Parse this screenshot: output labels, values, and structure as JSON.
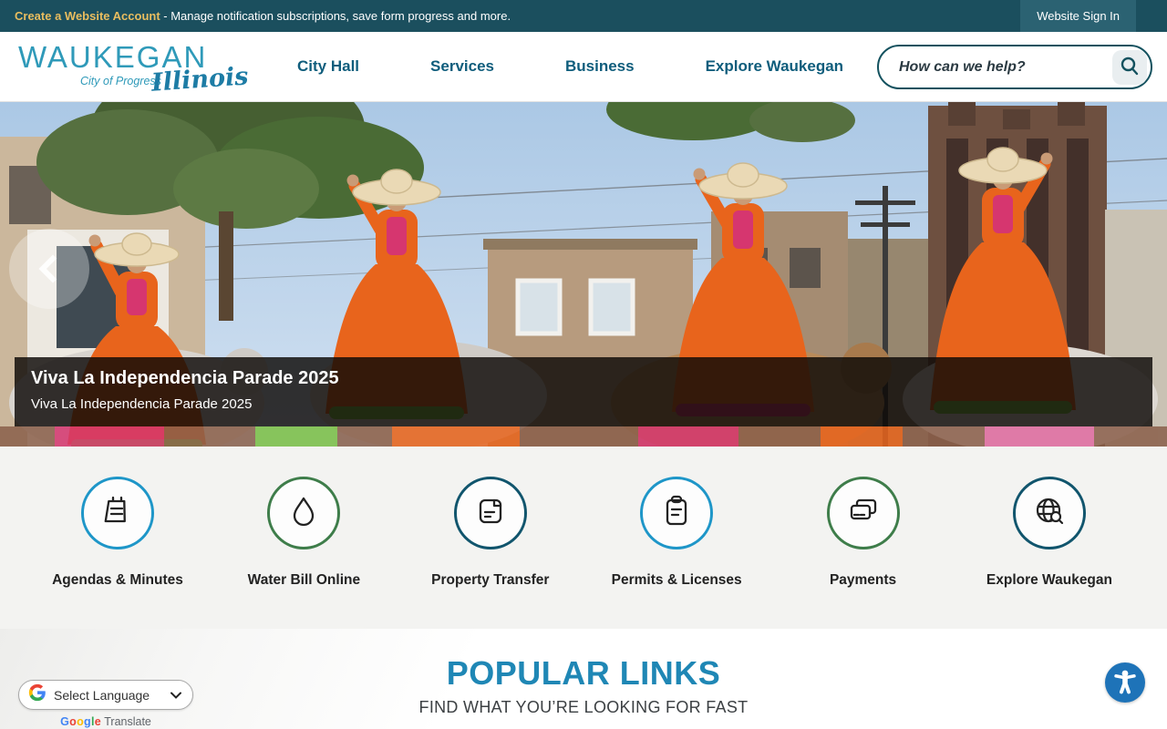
{
  "topbar": {
    "promo_link": "Create a Website Account",
    "promo_rest": " - Manage notification subscriptions, save form progress and more.",
    "signin_label": "Website Sign In"
  },
  "header": {
    "logo": {
      "name": "WAUKEGAN",
      "tagline": "City of Progress",
      "script": "Illinois"
    },
    "nav": [
      {
        "label": "City Hall"
      },
      {
        "label": "Services"
      },
      {
        "label": "Business"
      },
      {
        "label": "Explore Waukegan"
      }
    ],
    "search": {
      "placeholder": "How can we help?"
    }
  },
  "hero": {
    "caption_title": "Viva La Independencia Parade 2025",
    "caption_subtitle": "Viva La Independencia Parade 2025"
  },
  "quicklinks": {
    "items": [
      {
        "label": "Agendas & Minutes",
        "icon": "notepad-icon",
        "circle_color": "#1e96c8"
      },
      {
        "label": "Water Bill Online",
        "icon": "water-drop-icon",
        "circle_color": "#3e7d4a"
      },
      {
        "label": "Property Transfer",
        "icon": "document-icon",
        "circle_color": "#11556d"
      },
      {
        "label": "Permits & Licenses",
        "icon": "clipboard-icon",
        "circle_color": "#1e96c8"
      },
      {
        "label": "Payments",
        "icon": "credit-card-icon",
        "circle_color": "#3e7d4a"
      },
      {
        "label": "Explore Waukegan",
        "icon": "globe-search-icon",
        "circle_color": "#11556d"
      }
    ]
  },
  "popular": {
    "title": "POPULAR LINKS",
    "subtitle": "FIND WHAT YOU’RE LOOKING FOR FAST"
  },
  "translate": {
    "select_label": "Select Language",
    "brand": "Google",
    "brand_suffix": " Translate",
    "brand_colors": [
      "#4285F4",
      "#EA4335",
      "#FBBC05",
      "#4285F4",
      "#34A853",
      "#EA4335"
    ]
  },
  "colors": {
    "topbar_bg": "#1b4f5e",
    "promo_gold": "#e9bd5f",
    "nav_teal": "#0f5d7c",
    "logo_blue": "#2f9ab9",
    "heading_blue": "#1f87b5",
    "accessibility_blue": "#1e73b8"
  }
}
